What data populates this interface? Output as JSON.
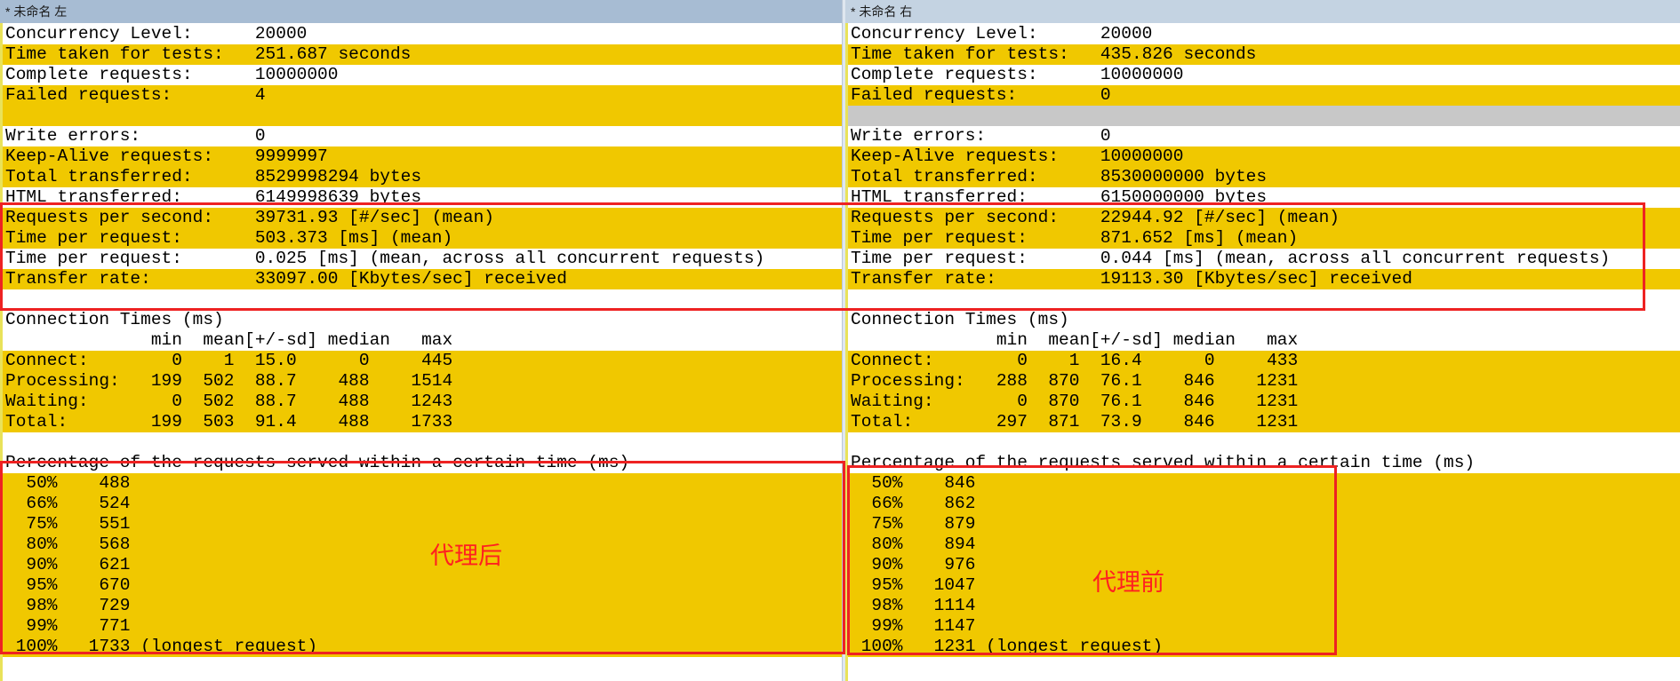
{
  "left": {
    "title": "* 未命名 左",
    "lines": [
      {
        "t": "Concurrency Level:      20000",
        "hl": false
      },
      {
        "t": "Time taken for tests:   251.687 seconds",
        "hl": true
      },
      {
        "t": "Complete requests:      10000000",
        "hl": false
      },
      {
        "t": "Failed requests:        4",
        "hl": true
      },
      {
        "t": "",
        "hl": true
      },
      {
        "t": "Write errors:           0",
        "hl": false
      },
      {
        "t": "Keep-Alive requests:    9999997",
        "hl": true
      },
      {
        "t": "Total transferred:      8529998294 bytes",
        "hl": true
      },
      {
        "t": "HTML transferred:       6149998639 bytes",
        "hl": false
      },
      {
        "t": "Requests per second:    39731.93 [#/sec] (mean)",
        "hl": true
      },
      {
        "t": "Time per request:       503.373 [ms] (mean)",
        "hl": true
      },
      {
        "t": "Time per request:       0.025 [ms] (mean, across all concurrent requests)",
        "hl": false
      },
      {
        "t": "Transfer rate:          33097.00 [Kbytes/sec] received",
        "hl": true
      },
      {
        "t": "",
        "hl": false
      },
      {
        "t": "Connection Times (ms)",
        "hl": false
      },
      {
        "t": "              min  mean[+/-sd] median   max",
        "hl": false
      },
      {
        "t": "Connect:        0    1  15.0      0     445",
        "hl": true
      },
      {
        "t": "Processing:   199  502  88.7    488    1514",
        "hl": true
      },
      {
        "t": "Waiting:        0  502  88.7    488    1243",
        "hl": true
      },
      {
        "t": "Total:        199  503  91.4    488    1733",
        "hl": true
      },
      {
        "t": "",
        "hl": false
      },
      {
        "t": "Percentage of the requests served within a certain time (ms)",
        "hl": false
      },
      {
        "t": "  50%    488",
        "hl": true
      },
      {
        "t": "  66%    524",
        "hl": true
      },
      {
        "t": "  75%    551",
        "hl": true
      },
      {
        "t": "  80%    568",
        "hl": true
      },
      {
        "t": "  90%    621",
        "hl": true
      },
      {
        "t": "  95%    670",
        "hl": true
      },
      {
        "t": "  98%    729",
        "hl": true
      },
      {
        "t": "  99%    771",
        "hl": true
      },
      {
        "t": " 100%   1733 (longest request)",
        "hl": true
      }
    ],
    "annotation": "代理后"
  },
  "right": {
    "title": "* 未命名 右",
    "lines": [
      {
        "t": "Concurrency Level:      20000",
        "hl": false
      },
      {
        "t": "Time taken for tests:   435.826 seconds",
        "hl": true
      },
      {
        "t": "Complete requests:      10000000",
        "hl": false
      },
      {
        "t": "Failed requests:        0",
        "hl": true
      },
      {
        "t": "",
        "hl": "gray"
      },
      {
        "t": "Write errors:           0",
        "hl": false
      },
      {
        "t": "Keep-Alive requests:    10000000",
        "hl": true
      },
      {
        "t": "Total transferred:      8530000000 bytes",
        "hl": true
      },
      {
        "t": "HTML transferred:       6150000000 bytes",
        "hl": false
      },
      {
        "t": "Requests per second:    22944.92 [#/sec] (mean)",
        "hl": true
      },
      {
        "t": "Time per request:       871.652 [ms] (mean)",
        "hl": true
      },
      {
        "t": "Time per request:       0.044 [ms] (mean, across all concurrent requests)",
        "hl": false
      },
      {
        "t": "Transfer rate:          19113.30 [Kbytes/sec] received",
        "hl": true
      },
      {
        "t": "",
        "hl": false
      },
      {
        "t": "Connection Times (ms)",
        "hl": false
      },
      {
        "t": "              min  mean[+/-sd] median   max",
        "hl": false
      },
      {
        "t": "Connect:        0    1  16.4      0     433",
        "hl": true
      },
      {
        "t": "Processing:   288  870  76.1    846    1231",
        "hl": true
      },
      {
        "t": "Waiting:        0  870  76.1    846    1231",
        "hl": true
      },
      {
        "t": "Total:        297  871  73.9    846    1231",
        "hl": true
      },
      {
        "t": "",
        "hl": false
      },
      {
        "t": "Percentage of the requests served within a certain time (ms)",
        "hl": false
      },
      {
        "t": "  50%    846",
        "hl": true
      },
      {
        "t": "  66%    862",
        "hl": true
      },
      {
        "t": "  75%    879",
        "hl": true
      },
      {
        "t": "  80%    894",
        "hl": true
      },
      {
        "t": "  90%    976",
        "hl": true
      },
      {
        "t": "  95%   1047",
        "hl": true
      },
      {
        "t": "  98%   1114",
        "hl": true
      },
      {
        "t": "  99%   1147",
        "hl": true
      },
      {
        "t": " 100%   1231 (longest request)",
        "hl": true
      }
    ],
    "annotation": "代理前"
  },
  "colors": {
    "highlight": "#f0c800",
    "annotation_red": "#ee2222",
    "title_left_bg": "#a7bcd3",
    "title_right_bg": "#c4d3e2"
  }
}
